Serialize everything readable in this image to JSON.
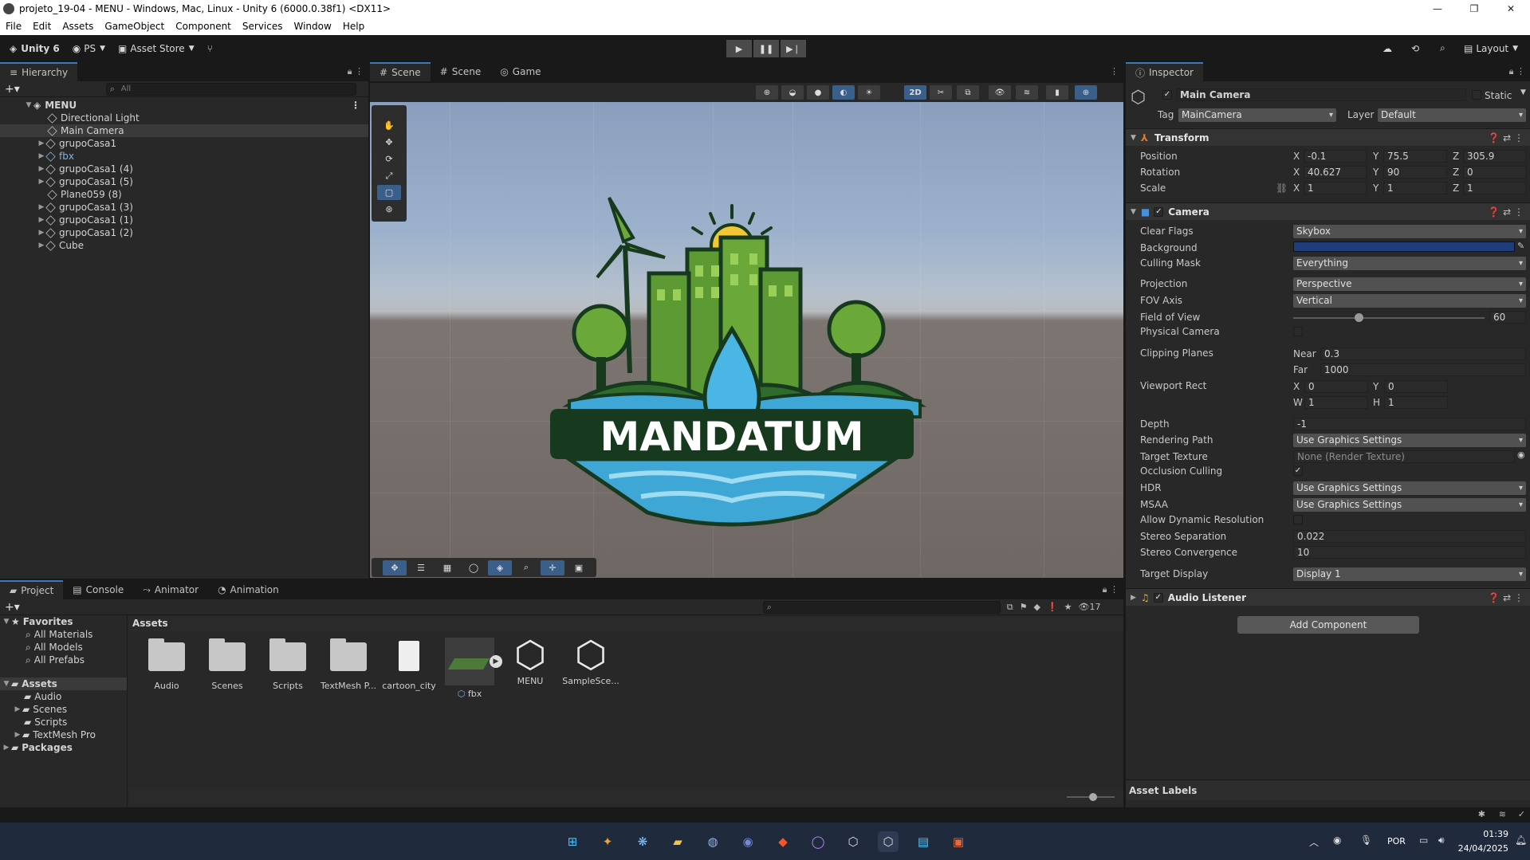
{
  "window": {
    "title": "projeto_19-04 - MENU - Windows, Mac, Linux - Unity 6 (6000.0.38f1) <DX11>",
    "minimize": "—",
    "maximize": "❐",
    "close": "✕"
  },
  "menu": [
    "File",
    "Edit",
    "Assets",
    "GameObject",
    "Component",
    "Services",
    "Window",
    "Help"
  ],
  "toolbar": {
    "account": "Unity 6",
    "ps": "PS",
    "asset_store": "Asset Store",
    "layout": "Layout"
  },
  "hierarchy": {
    "tab": "Hierarchy",
    "search_placeholder": "All",
    "root": "MENU",
    "items": [
      "Directional Light",
      "Main Camera",
      "grupoCasa1",
      "fbx",
      "grupoCasa1 (4)",
      "grupoCasa1 (5)",
      "Plane059 (8)",
      "grupoCasa1 (3)",
      "grupoCasa1 (1)",
      "grupoCasa1 (2)",
      "Cube"
    ]
  },
  "scene_tabs": [
    "Scene",
    "Scene",
    "Game"
  ],
  "scene": {
    "toggle_2d": "2D",
    "logo_text": "MANDATUM"
  },
  "inspector": {
    "tab": "Inspector",
    "object_name": "Main Camera",
    "static": "Static",
    "tag_label": "Tag",
    "tag": "MainCamera",
    "layer_label": "Layer",
    "layer": "Default",
    "transform": {
      "title": "Transform",
      "position_label": "Position",
      "rotation_label": "Rotation",
      "scale_label": "Scale",
      "position": {
        "x": "-0.1",
        "y": "75.5",
        "z": "305.9"
      },
      "rotation": {
        "x": "40.627",
        "y": "90",
        "z": "0"
      },
      "scale": {
        "x": "1",
        "y": "1",
        "z": "1"
      }
    },
    "camera": {
      "title": "Camera",
      "labels": {
        "clear_flags": "Clear Flags",
        "background": "Background",
        "culling_mask": "Culling Mask",
        "projection": "Projection",
        "fov_axis": "FOV Axis",
        "fov": "Field of View",
        "physical": "Physical Camera",
        "clipping": "Clipping Planes",
        "near": "Near",
        "far": "Far",
        "viewport": "Viewport Rect",
        "depth": "Depth",
        "rendering_path": "Rendering Path",
        "target_texture": "Target Texture",
        "occlusion": "Occlusion Culling",
        "hdr": "HDR",
        "msaa": "MSAA",
        "dynamic_res": "Allow Dynamic Resolution",
        "stereo_sep": "Stereo Separation",
        "stereo_conv": "Stereo Convergence",
        "target_display": "Target Display"
      },
      "values": {
        "clear_flags": "Skybox",
        "culling_mask": "Everything",
        "projection": "Perspective",
        "fov_axis": "Vertical",
        "fov": "60",
        "near": "0.3",
        "far": "1000",
        "vx": "0",
        "vy": "0",
        "vw": "1",
        "vh": "1",
        "depth": "-1",
        "rendering_path": "Use Graphics Settings",
        "target_texture": "None (Render Texture)",
        "hdr": "Use Graphics Settings",
        "msaa": "Use Graphics Settings",
        "stereo_sep": "0.022",
        "stereo_conv": "10",
        "target_display": "Display 1"
      },
      "fov_fraction": 0.34,
      "background_color": "#1f3d7a"
    },
    "audio_listener": "Audio Listener",
    "add_component": "Add Component",
    "asset_labels": "Asset Labels"
  },
  "bottom_tabs": [
    "Project",
    "Console",
    "Animator",
    "Animation"
  ],
  "project": {
    "favorites": "Favorites",
    "fav_items": [
      "All Materials",
      "All Models",
      "All Prefabs"
    ],
    "assets": "Assets",
    "asset_folders": [
      "Audio",
      "Scenes",
      "Scripts",
      "TextMesh Pro"
    ],
    "packages": "Packages",
    "breadcrumb": "Assets",
    "count": "17",
    "grid": [
      "Audio",
      "Scenes",
      "Scripts",
      "TextMesh P...",
      "cartoon_city",
      "fbx",
      "MENU",
      "SampleSce..."
    ]
  },
  "taskbar": {
    "lang": "POR",
    "time": "01:39",
    "date": "24/04/2025"
  }
}
